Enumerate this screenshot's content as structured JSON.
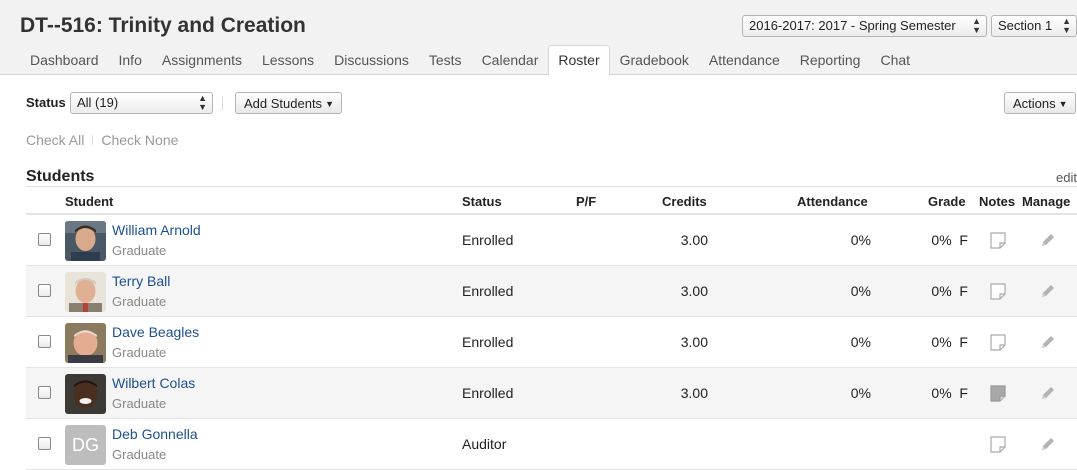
{
  "course": {
    "title": "DT--516: Trinity and Creation",
    "term_select": "2016-2017: 2017 - Spring Semester",
    "section_select": "Section 1"
  },
  "tabs": [
    {
      "label": "Dashboard",
      "active": false
    },
    {
      "label": "Info",
      "active": false
    },
    {
      "label": "Assignments",
      "active": false
    },
    {
      "label": "Lessons",
      "active": false
    },
    {
      "label": "Discussions",
      "active": false
    },
    {
      "label": "Tests",
      "active": false
    },
    {
      "label": "Calendar",
      "active": false
    },
    {
      "label": "Roster",
      "active": true
    },
    {
      "label": "Gradebook",
      "active": false
    },
    {
      "label": "Attendance",
      "active": false
    },
    {
      "label": "Reporting",
      "active": false
    },
    {
      "label": "Chat",
      "active": false
    }
  ],
  "toolbar": {
    "status_label": "Status",
    "status_value": "All (19)",
    "add_students_label": "Add Students",
    "actions_label": "Actions"
  },
  "check": {
    "all": "Check All",
    "none": "Check None"
  },
  "students": {
    "heading": "Students",
    "edit_label": "edit",
    "columns": {
      "student": "Student",
      "status": "Status",
      "pf": "P/F",
      "credits": "Credits",
      "attendance": "Attendance",
      "grade": "Grade",
      "notes": "Notes",
      "manage": "Manage"
    },
    "rows": [
      {
        "name": "William Arnold",
        "level": "Graduate",
        "status": "Enrolled",
        "credits": "3.00",
        "attendance": "0%",
        "grade": "0%  F",
        "has_note": false,
        "avatar_initials": ""
      },
      {
        "name": "Terry Ball",
        "level": "Graduate",
        "status": "Enrolled",
        "credits": "3.00",
        "attendance": "0%",
        "grade": "0%  F",
        "has_note": false,
        "avatar_initials": ""
      },
      {
        "name": "Dave Beagles",
        "level": "Graduate",
        "status": "Enrolled",
        "credits": "3.00",
        "attendance": "0%",
        "grade": "0%  F",
        "has_note": false,
        "avatar_initials": ""
      },
      {
        "name": "Wilbert Colas",
        "level": "Graduate",
        "status": "Enrolled",
        "credits": "3.00",
        "attendance": "0%",
        "grade": "0%  F",
        "has_note": true,
        "avatar_initials": ""
      },
      {
        "name": "Deb Gonnella",
        "level": "Graduate",
        "status": "Auditor",
        "credits": "",
        "attendance": "",
        "grade": "",
        "has_note": false,
        "avatar_initials": "DG"
      }
    ]
  },
  "colors": {
    "link": "#1d4f91",
    "muted": "#888888",
    "header_bg": "#f2f2f2"
  }
}
